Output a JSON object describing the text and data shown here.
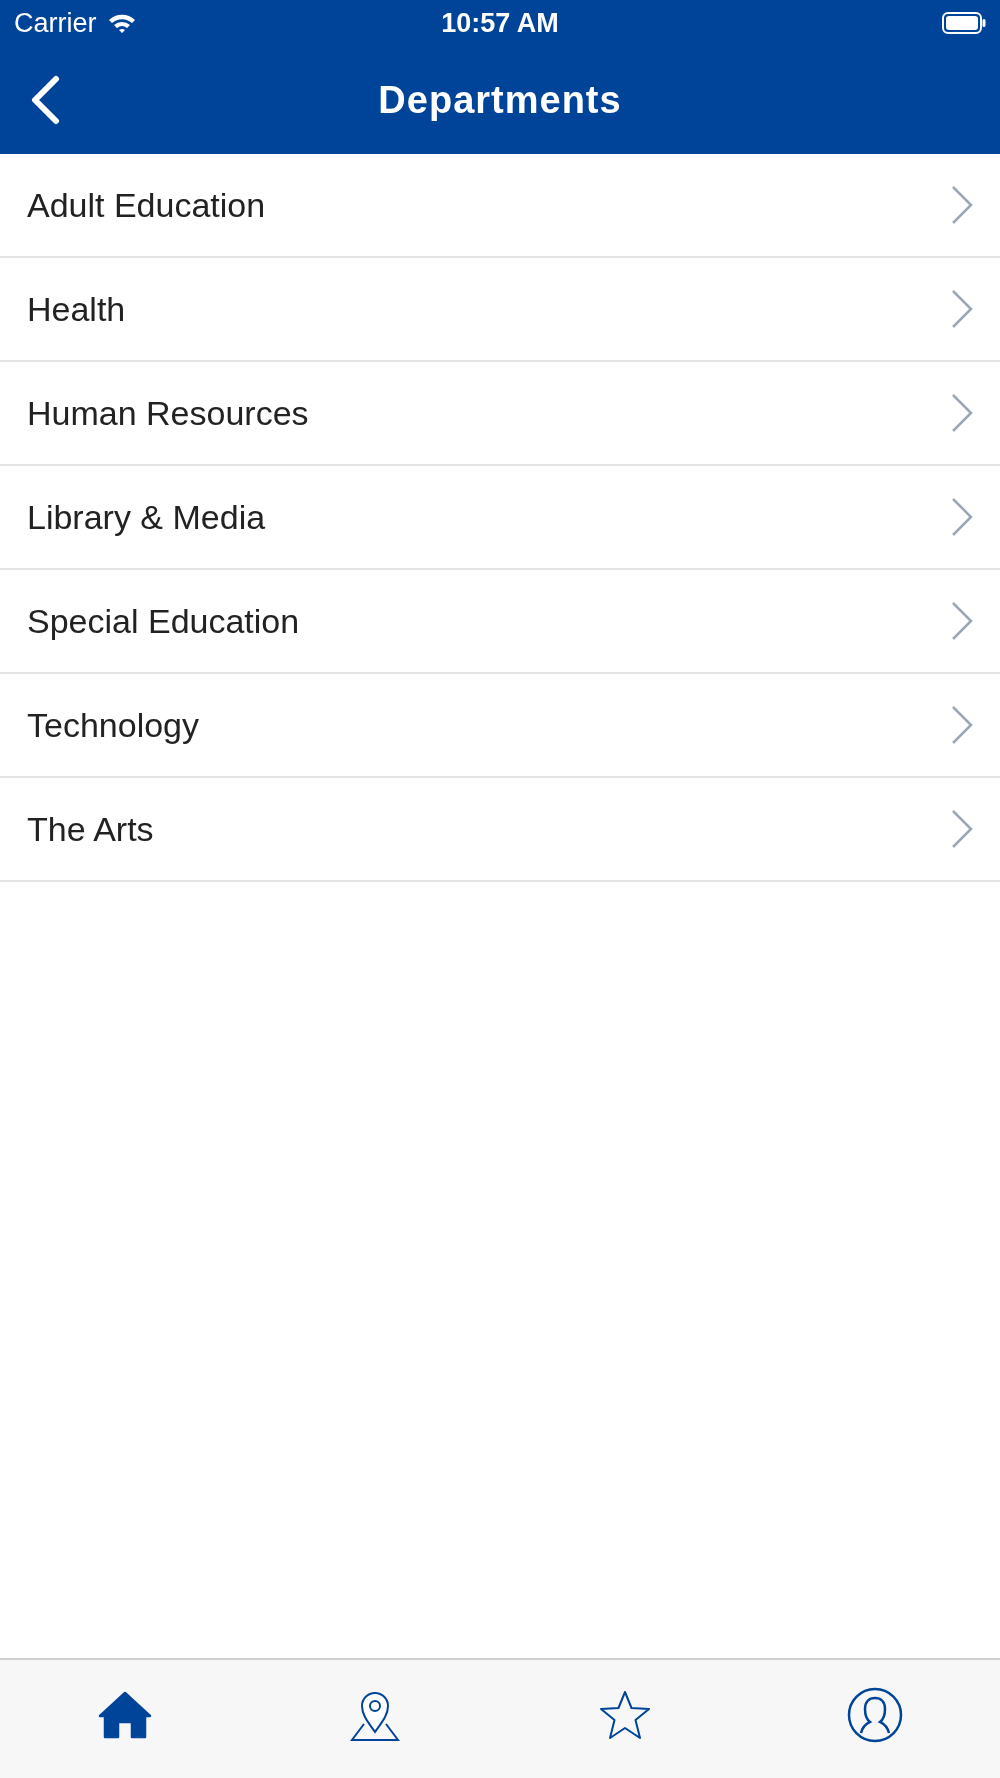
{
  "status_bar": {
    "carrier": "Carrier",
    "time": "10:57 AM"
  },
  "nav_bar": {
    "title": "Departments"
  },
  "departments": [
    {
      "label": "Adult Education"
    },
    {
      "label": "Health"
    },
    {
      "label": "Human Resources"
    },
    {
      "label": "Library & Media"
    },
    {
      "label": "Special Education"
    },
    {
      "label": "Technology"
    },
    {
      "label": "The Arts"
    }
  ],
  "tab_bar": [
    {
      "kind": "home",
      "selected": true
    },
    {
      "kind": "map",
      "selected": false
    },
    {
      "kind": "favorites",
      "selected": false
    },
    {
      "kind": "profile",
      "selected": false
    }
  ]
}
